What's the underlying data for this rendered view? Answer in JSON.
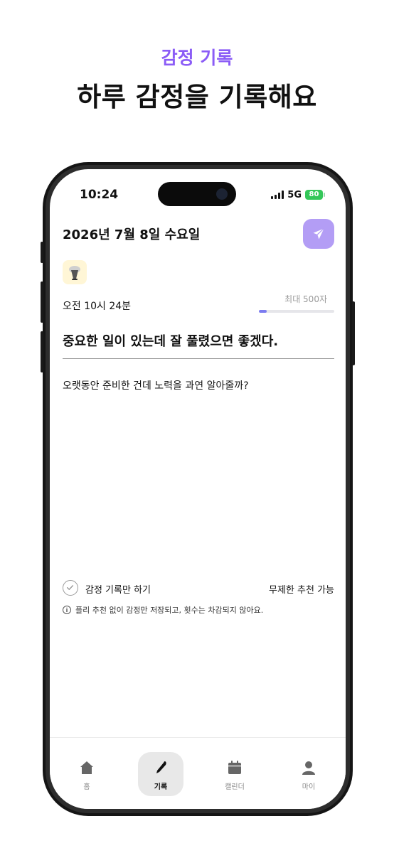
{
  "marketing": {
    "kicker": "감정 기록",
    "headline": "하루 감정을 기록해요"
  },
  "status_bar": {
    "time": "10:24",
    "network": "5G",
    "battery": "80"
  },
  "editor": {
    "date_title": "2026년 7월 8일 수요일",
    "send_icon": "paper-plane-icon",
    "emoji_icon": "lamp-icon",
    "time_text": "오전 10시 24분",
    "max_chars": "최대 500자",
    "char_progress": 0.1,
    "title": "중요한 일이 있는데 잘 풀렸으면 좋겠다.",
    "body": "오랫동안 준비한 건데 노력을 과연 알아줄까?"
  },
  "options": {
    "only_record_label": "감정 기록만 하기",
    "unlimited_label": "무제한 추천 가능",
    "info_text": "플리 추천 없이 감정만 저장되고, 횟수는 차감되지 않아요."
  },
  "tabs": [
    {
      "label": "홈",
      "icon": "home-icon",
      "active": false
    },
    {
      "label": "기록",
      "icon": "pen-icon",
      "active": true
    },
    {
      "label": "캘린더",
      "icon": "calendar-icon",
      "active": false
    },
    {
      "label": "마이",
      "icon": "user-icon",
      "active": false
    }
  ],
  "colors": {
    "accent": "#8B5CF6",
    "send_button": "#B39DF5",
    "battery": "#34C759"
  }
}
